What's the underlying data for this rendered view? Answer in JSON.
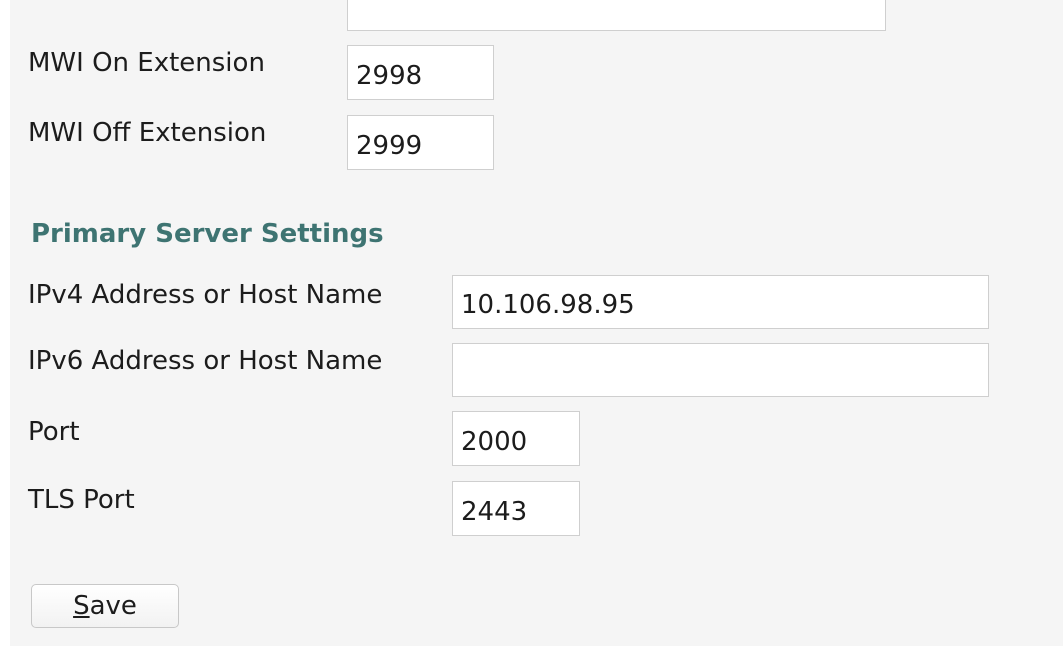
{
  "form": {
    "top_field_value": "",
    "mwi_on": {
      "label": "MWI On Extension",
      "value": "2998"
    },
    "mwi_off": {
      "label": "MWI Off Extension",
      "value": "2999"
    }
  },
  "primary_server": {
    "section_title": "Primary Server Settings",
    "ipv4": {
      "label": "IPv4 Address or Host Name",
      "value": "10.106.98.95"
    },
    "ipv6": {
      "label": "IPv6 Address or Host Name",
      "value": ""
    },
    "port": {
      "label": "Port",
      "value": "2000"
    },
    "tls_port": {
      "label": "TLS Port",
      "value": "2443"
    }
  },
  "actions": {
    "save_mnemonic": "S",
    "save_rest": "ave"
  }
}
